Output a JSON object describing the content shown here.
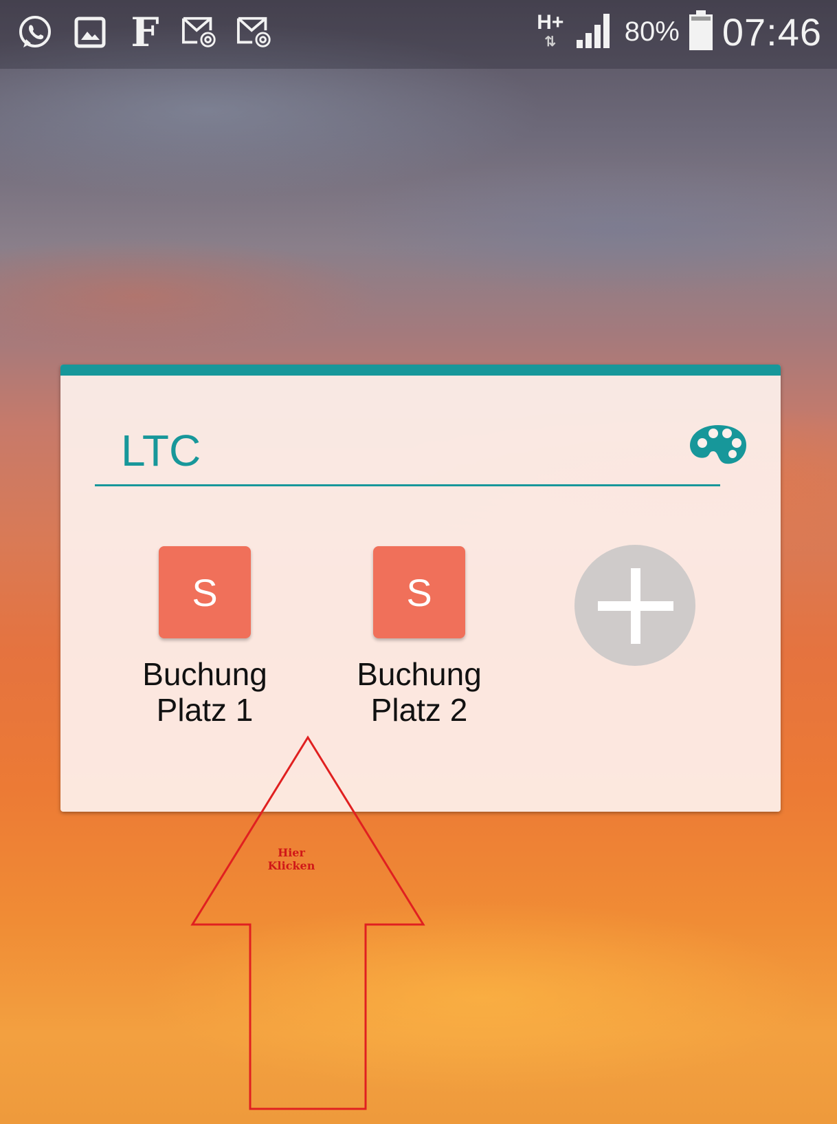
{
  "status_bar": {
    "notification_icons": [
      "whatsapp-icon",
      "gallery-icon",
      "f-app-icon",
      "email-icon",
      "email-icon"
    ],
    "f_glyph": "F",
    "network_type": "H+",
    "network_arrows": "⇅",
    "battery_percent": "80%",
    "time": "07:46"
  },
  "widget": {
    "title": "LTC",
    "accent_color": "#17979a",
    "palette_icon": "palette-icon",
    "shortcuts": [
      {
        "tile_letter": "S",
        "label_line1": "Buchung",
        "label_line2": "Platz 1"
      },
      {
        "tile_letter": "S",
        "label_line1": "Buchung",
        "label_line2": "Platz 2"
      }
    ],
    "tile_color": "#f0705a",
    "add_icon": "plus-icon"
  },
  "annotation": {
    "arrow_color": "#e02020",
    "line1": "Hier",
    "line2": "Klicken"
  }
}
